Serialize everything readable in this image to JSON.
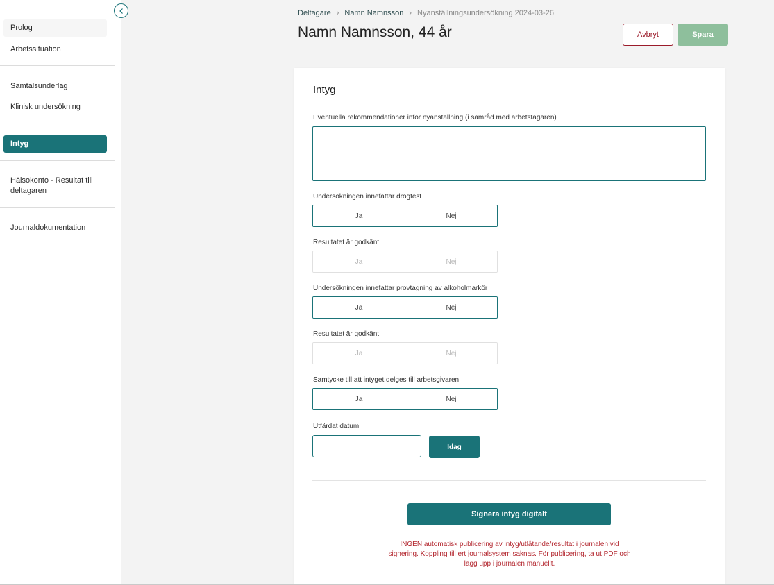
{
  "sidebar": {
    "items": [
      {
        "label": "Prolog"
      },
      {
        "label": "Arbetssituation"
      },
      {
        "label": "Samtalsunderlag"
      },
      {
        "label": "Klinisk undersökning"
      },
      {
        "label": "Intyg"
      },
      {
        "label": "Hälsokonto - Resultat till deltagaren"
      },
      {
        "label": "Journaldokumentation"
      }
    ]
  },
  "breadcrumb": {
    "items": [
      "Deltagare",
      "Namn Namnsson",
      "Nyanställningsundersökning 2024-03-26"
    ]
  },
  "header": {
    "title": "Namn Namnsson, 44 år",
    "cancel_label": "Avbryt",
    "save_label": "Spara"
  },
  "card": {
    "title": "Intyg",
    "recommendation_label": "Eventuella rekommendationer inför nyanställning (i samråd med arbetstagaren)",
    "recommendation_value": "",
    "questions": [
      {
        "label": "Undersökningen innefattar drogtest",
        "yes": "Ja",
        "no": "Nej",
        "enabled": true
      },
      {
        "label": "Resultatet är godkänt",
        "yes": "Ja",
        "no": "Nej",
        "enabled": false
      },
      {
        "label": "Undersökningen innefattar provtagning av alkoholmarkör",
        "yes": "Ja",
        "no": "Nej",
        "enabled": true
      },
      {
        "label": "Resultatet är godkänt",
        "yes": "Ja",
        "no": "Nej",
        "enabled": false
      },
      {
        "label": "Samtycke till att intyget delges till arbetsgivaren",
        "yes": "Ja",
        "no": "Nej",
        "enabled": true
      }
    ],
    "date_label": "Utfärdat datum",
    "date_value": "",
    "today_label": "Idag",
    "sign_label": "Signera intyg digitalt",
    "warning": "INGEN automatisk publicering av intyg/utlåtande/resultat i journalen vid signering. Koppling till ert journalsystem saknas. För publicering, ta ut PDF och lägg upp i journalen manuellt."
  },
  "colors": {
    "accent": "#1a7378",
    "cancel": "#9b1b2a",
    "save_disabled": "#8ebf9c",
    "warning": "#b3262e"
  }
}
